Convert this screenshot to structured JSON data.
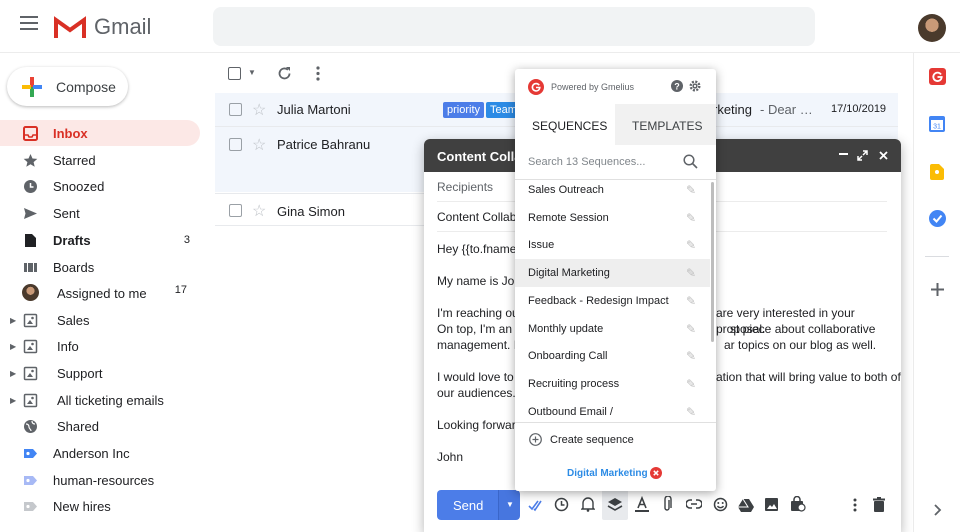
{
  "app": {
    "name": "Gmail"
  },
  "sidebar": {
    "compose_label": "Compose",
    "items": [
      {
        "label": "Inbox",
        "count": ""
      },
      {
        "label": "Starred",
        "count": ""
      },
      {
        "label": "Snoozed",
        "count": ""
      },
      {
        "label": "Sent",
        "count": ""
      },
      {
        "label": "Drafts",
        "count": "3"
      },
      {
        "label": "Boards",
        "count": ""
      },
      {
        "label": "Assigned to me",
        "count": "17"
      },
      {
        "label": "Sales",
        "count": ""
      },
      {
        "label": "Info",
        "count": ""
      },
      {
        "label": "Support",
        "count": ""
      },
      {
        "label": "All ticketing emails",
        "count": ""
      },
      {
        "label": "Shared",
        "count": ""
      },
      {
        "label": "Anderson Inc",
        "count": ""
      },
      {
        "label": "human-resources",
        "count": ""
      },
      {
        "label": "New hires",
        "count": ""
      }
    ]
  },
  "emails": [
    {
      "sender": "Julia Martoni",
      "badges": [
        "priority",
        "Team"
      ],
      "subject_tail": "rketing",
      "snippet": " - Dear …",
      "date": "17/10/2019"
    },
    {
      "sender": "Patrice Bahranu"
    },
    {
      "sender": "Gina Simon"
    }
  ],
  "compose": {
    "title": "Content Collab",
    "recipients_placeholder": "Recipients",
    "subject": "Content Collab",
    "body_left": [
      "Hey {{to.fname}},",
      "My name is John",
      "I'm reaching out",
      "On top, I'm an a",
      "management. It",
      "I would love to g",
      "our audiences.",
      "Looking forward",
      "John"
    ],
    "body_right": [
      "are very interested in your proposal.",
      "st piece about collaborative",
      "ar topics on our blog as well.",
      "ation that will bring value to both of"
    ],
    "send_label": "Send"
  },
  "popup": {
    "powered_by": "Powered by Gmelius",
    "tabs": [
      "SEQUENCES",
      "TEMPLATES"
    ],
    "search_placeholder": "Search 13 Sequences...",
    "sequences": [
      "Sales Outreach",
      "Remote Session",
      "Issue",
      "Digital Marketing",
      "Feedback - Redesign Impact",
      "Monthly update",
      "Onboarding Call",
      "Recruiting process",
      "Outbound Email /"
    ],
    "create_label": "Create sequence",
    "selected": "Digital Marketing"
  },
  "colors": {
    "accent": "#4c7de8",
    "gmail_red": "#d93025",
    "gmelius": "#e53935",
    "priority_badge": "#4c7de8",
    "team_badge": "#2c8be5"
  }
}
